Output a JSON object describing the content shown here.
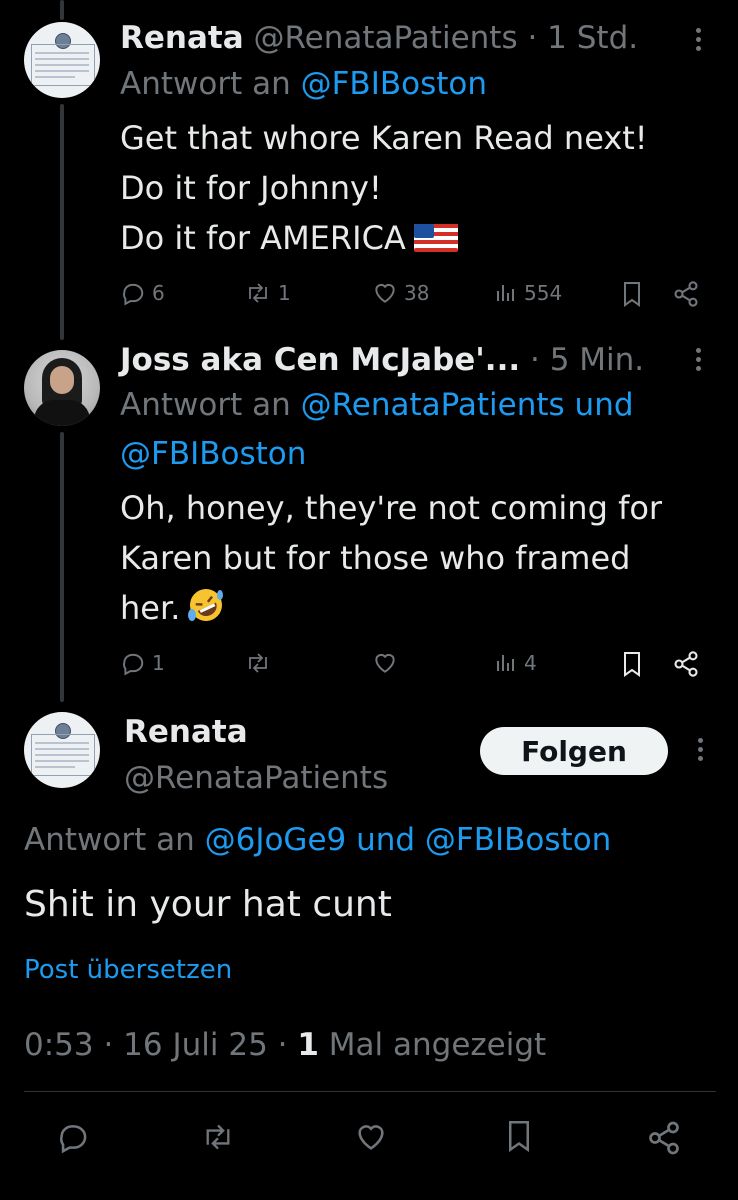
{
  "posts": [
    {
      "name": "Renata",
      "handle": "@RenataPatients",
      "time": "· 1 Std.",
      "reply_prefix": "Antwort an",
      "reply_to": "@FBIBoston",
      "lines": [
        "Get that whore Karen Read next!",
        "Do it for Johnny!",
        "Do it for AMERICA"
      ],
      "replies": "6",
      "reposts": "1",
      "likes": "38",
      "views": "554"
    },
    {
      "name": "Joss aka Cen McJabe'...",
      "time": "· 5 Min.",
      "reply_prefix": "Antwort an",
      "reply_to_line1": "@RenataPatients und",
      "reply_to_line2": "@FBIBoston",
      "lines": [
        "Oh, honey, they're not coming for",
        "Karen but for those who framed",
        "her."
      ],
      "replies": "1",
      "views": "4"
    }
  ],
  "main": {
    "name": "Renata",
    "handle": "@RenataPatients",
    "follow_label": "Folgen",
    "reply_prefix": "Antwort an",
    "reply_to": "@6JoGe9 und @FBIBoston",
    "text": "Shit in your hat cunt",
    "translate": "Post übersetzen",
    "timestamp": "0:53 · 16 Juli 25 ·",
    "views_count": "1",
    "views_label": "Mal angezeigt"
  },
  "icons": {
    "reply": "reply-icon",
    "repost": "repost-icon",
    "like": "heart-icon",
    "views": "views-icon",
    "bookmark": "bookmark-icon",
    "share": "share-icon",
    "more": "more-icon"
  },
  "colors": {
    "background": "#000000",
    "text": "#e7e9ea",
    "muted": "#71767b",
    "link": "#1d9bf0",
    "follow_bg": "#eff3f4"
  }
}
